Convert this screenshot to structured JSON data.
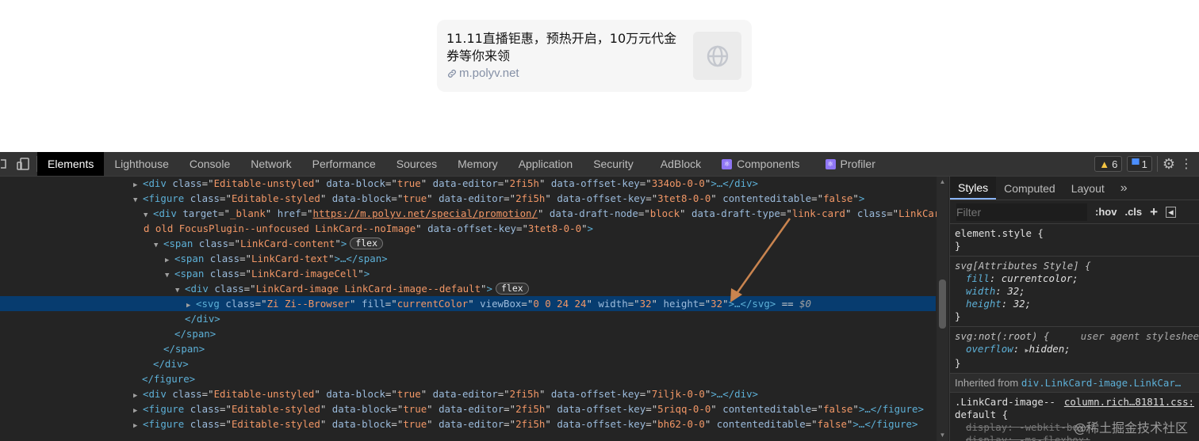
{
  "link_card": {
    "title": "11.11直播钜惠，预热开启，10万元代金券等你来领",
    "url": "m.polyv.net"
  },
  "devtools": {
    "tabs": [
      {
        "label": "Elements",
        "active": true
      },
      {
        "label": "Lighthouse"
      },
      {
        "label": "Console"
      },
      {
        "label": "Network"
      },
      {
        "label": "Performance"
      },
      {
        "label": "Sources"
      },
      {
        "label": "Memory"
      },
      {
        "label": "Application"
      },
      {
        "label": "Security"
      },
      {
        "label": "AdBlock"
      },
      {
        "label": "Components",
        "icon": "react-icon"
      },
      {
        "label": "Profiler",
        "icon": "react-icon"
      }
    ],
    "warnings_count": "6",
    "messages_count": "1",
    "dom": {
      "l0": {
        "tag": "div",
        "attrs": [
          [
            "class",
            "Editable-unstyled"
          ],
          [
            "data-block",
            "true"
          ],
          [
            "data-editor",
            "2fi5h"
          ],
          [
            "data-offset-key",
            "334ob-0-0"
          ]
        ],
        "close": "…</div>"
      },
      "l1": {
        "tag": "figure",
        "attrs": [
          [
            "class",
            "Editable-styled"
          ],
          [
            "data-block",
            "true"
          ],
          [
            "data-editor",
            "2fi5h"
          ],
          [
            "data-offset-key",
            "3tet8-0-0"
          ],
          [
            "contenteditable",
            "false"
          ]
        ]
      },
      "l2": {
        "tag": "div",
        "attr_target": "target",
        "val_target": "_blank",
        "attr_href": "href",
        "val_href": "https://m.polyv.net/special/promotion/",
        "attr_node": "data-draft-node",
        "val_node": "block",
        "attr_type": "data-draft-type",
        "val_type": "link-card",
        "attr_class": "class",
        "val_class_a": "LinkCar",
        "val_class_b": "d old FocusPlugin--unfocused LinkCard--noImage",
        "attr_key": "data-offset-key",
        "val_key": "3tet8-0-0"
      },
      "l3": {
        "tag": "span",
        "attr": "class",
        "val": "LinkCard-content",
        "badge": "flex"
      },
      "l4": {
        "tag": "span",
        "attr": "class",
        "val": "LinkCard-text",
        "close": "…</span>"
      },
      "l5": {
        "tag": "span",
        "attr": "class",
        "val": "LinkCard-imageCell"
      },
      "l6": {
        "tag": "div",
        "attr": "class",
        "val": "LinkCard-image LinkCard-image--default",
        "badge": "flex"
      },
      "l7": {
        "tag": "svg",
        "attrs": [
          [
            "class",
            "Zi Zi--Browser"
          ],
          [
            "fill",
            "currentColor"
          ],
          [
            "viewBox",
            "0 0 24 24"
          ],
          [
            "width",
            "32"
          ],
          [
            "height",
            "32"
          ]
        ],
        "close": "…</svg>",
        "eq": " == ",
        "ref": "$0"
      },
      "l8": "</div>",
      "l9": "</span>",
      "l10": "</span>",
      "l11": "</div>",
      "l12": "</figure>",
      "l13": {
        "tag": "div",
        "attrs": [
          [
            "class",
            "Editable-unstyled"
          ],
          [
            "data-block",
            "true"
          ],
          [
            "data-editor",
            "2fi5h"
          ],
          [
            "data-offset-key",
            "7iljk-0-0"
          ]
        ],
        "close": "…</div>"
      },
      "l14": {
        "tag": "figure",
        "attrs": [
          [
            "class",
            "Editable-styled"
          ],
          [
            "data-block",
            "true"
          ],
          [
            "data-editor",
            "2fi5h"
          ],
          [
            "data-offset-key",
            "5riqq-0-0"
          ],
          [
            "contenteditable",
            "false"
          ]
        ],
        "close": "…</figure>"
      },
      "l15": {
        "tag": "figure",
        "attrs": [
          [
            "class",
            "Editable-styled"
          ],
          [
            "data-block",
            "true"
          ],
          [
            "data-editor",
            "2fi5h"
          ],
          [
            "data-offset-key",
            "bh62-0-0"
          ],
          [
            "contenteditable",
            "false"
          ]
        ],
        "close": "…</figure>"
      }
    },
    "styles": {
      "tabs": [
        "Styles",
        "Computed",
        "Layout"
      ],
      "filter_placeholder": "Filter",
      "hov": ":hov",
      "cls": ".cls",
      "element_style": "element.style {",
      "close_brace": "}",
      "attr_style_selector": "svg[Attributes Style] {",
      "attr_props": [
        [
          "fill",
          "currentcolor"
        ],
        [
          "width",
          "32"
        ],
        [
          "height",
          "32"
        ]
      ],
      "ua_selector": "svg:not(:root) {",
      "ua_label": "user agent styleshee",
      "ua_prop": [
        "overflow",
        "hidden"
      ],
      "inherited_label": "Inherited from",
      "inherited_from": "div.LinkCard-image.LinkCar…",
      "rule_selector_a": ".LinkCard-image--",
      "rule_selector_b": "default {",
      "rule_source": "column.rich…81811.css:",
      "rule_prop": [
        "display",
        "-webkit-box"
      ],
      "rule_prop2": "display: -ms-flexbox;"
    },
    "watermark": "@稀土掘金技术社区"
  }
}
